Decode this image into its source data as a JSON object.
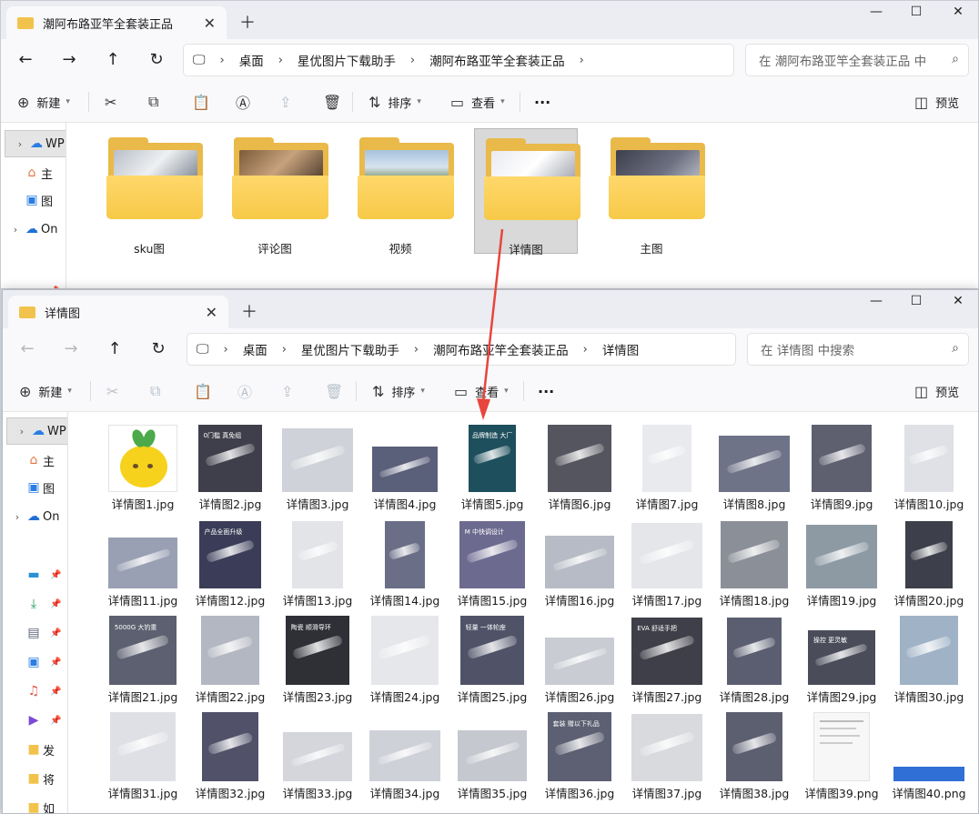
{
  "back_window": {
    "tab_title": "潮阿布路亚竿全套装正品",
    "breadcrumb": [
      "桌面",
      "星优图片下载助手",
      "潮阿布路亚竿全套装正品"
    ],
    "search_placeholder": "在 潮阿布路亚竿全套装正品 中",
    "folders": [
      {
        "label": "sku图",
        "selected": false
      },
      {
        "label": "评论图",
        "selected": false
      },
      {
        "label": "视频",
        "selected": false
      },
      {
        "label": "详情图",
        "selected": true
      },
      {
        "label": "主图",
        "selected": false
      }
    ]
  },
  "front_window": {
    "tab_title": "详情图",
    "breadcrumb": [
      "桌面",
      "星优图片下载助手",
      "潮阿布路亚竿全套装正品",
      "详情图"
    ],
    "search_placeholder": "在 详情图 中搜索"
  },
  "toolbar": {
    "new_label": "新建",
    "sort_label": "排序",
    "view_label": "查看",
    "more_label": "···",
    "preview_label": "预览"
  },
  "sidebar_back": [
    "WP",
    "主",
    "图",
    "On"
  ],
  "sidebar_front": [
    "WP",
    "主",
    "图",
    "On",
    "",
    "",
    "",
    "",
    "",
    "",
    "发",
    "将",
    "如"
  ],
  "files": [
    {
      "name": "详情图1.jpg",
      "caption": ""
    },
    {
      "name": "详情图2.jpg",
      "caption": "0门槛 真免组"
    },
    {
      "name": "详情图3.jpg",
      "caption": ""
    },
    {
      "name": "详情图4.jpg",
      "caption": ""
    },
    {
      "name": "详情图5.jpg",
      "caption": "品牌制造 大厂直销"
    },
    {
      "name": "详情图6.jpg",
      "caption": ""
    },
    {
      "name": "详情图7.jpg",
      "caption": ""
    },
    {
      "name": "详情图8.jpg",
      "caption": ""
    },
    {
      "name": "详情图9.jpg",
      "caption": ""
    },
    {
      "name": "详情图10.jpg",
      "caption": ""
    },
    {
      "name": "详情图11.jpg",
      "caption": ""
    },
    {
      "name": "详情图12.jpg",
      "caption": "产品全面升级"
    },
    {
      "name": "详情图13.jpg",
      "caption": ""
    },
    {
      "name": "详情图14.jpg",
      "caption": ""
    },
    {
      "name": "详情图15.jpg",
      "caption": "M 中快调设计"
    },
    {
      "name": "详情图16.jpg",
      "caption": ""
    },
    {
      "name": "详情图17.jpg",
      "caption": ""
    },
    {
      "name": "详情图18.jpg",
      "caption": ""
    },
    {
      "name": "详情图19.jpg",
      "caption": ""
    },
    {
      "name": "详情图20.jpg",
      "caption": ""
    },
    {
      "name": "详情图21.jpg",
      "caption": "5000G 大钓重"
    },
    {
      "name": "详情图22.jpg",
      "caption": ""
    },
    {
      "name": "详情图23.jpg",
      "caption": "陶瓷 顺滑导环"
    },
    {
      "name": "详情图24.jpg",
      "caption": ""
    },
    {
      "name": "详情图25.jpg",
      "caption": "轻量 一体轮座"
    },
    {
      "name": "详情图26.jpg",
      "caption": ""
    },
    {
      "name": "详情图27.jpg",
      "caption": "EVA 舒适手把"
    },
    {
      "name": "详情图28.jpg",
      "caption": ""
    },
    {
      "name": "详情图29.jpg",
      "caption": "操控 更灵敏"
    },
    {
      "name": "详情图30.jpg",
      "caption": ""
    },
    {
      "name": "详情图31.jpg",
      "caption": ""
    },
    {
      "name": "详情图32.jpg",
      "caption": ""
    },
    {
      "name": "详情图33.jpg",
      "caption": ""
    },
    {
      "name": "详情图34.jpg",
      "caption": ""
    },
    {
      "name": "详情图35.jpg",
      "caption": ""
    },
    {
      "name": "详情图36.jpg",
      "caption": "套装 赠以下礼品"
    },
    {
      "name": "详情图37.jpg",
      "caption": ""
    },
    {
      "name": "详情图38.jpg",
      "caption": ""
    },
    {
      "name": "详情图39.png",
      "caption": ""
    },
    {
      "name": "详情图40.png",
      "caption": ""
    }
  ],
  "colors": {
    "accent_arrow": "#e8453c",
    "folder_yellow": "#f7c948",
    "thumb_dark": "#4a4a58"
  }
}
